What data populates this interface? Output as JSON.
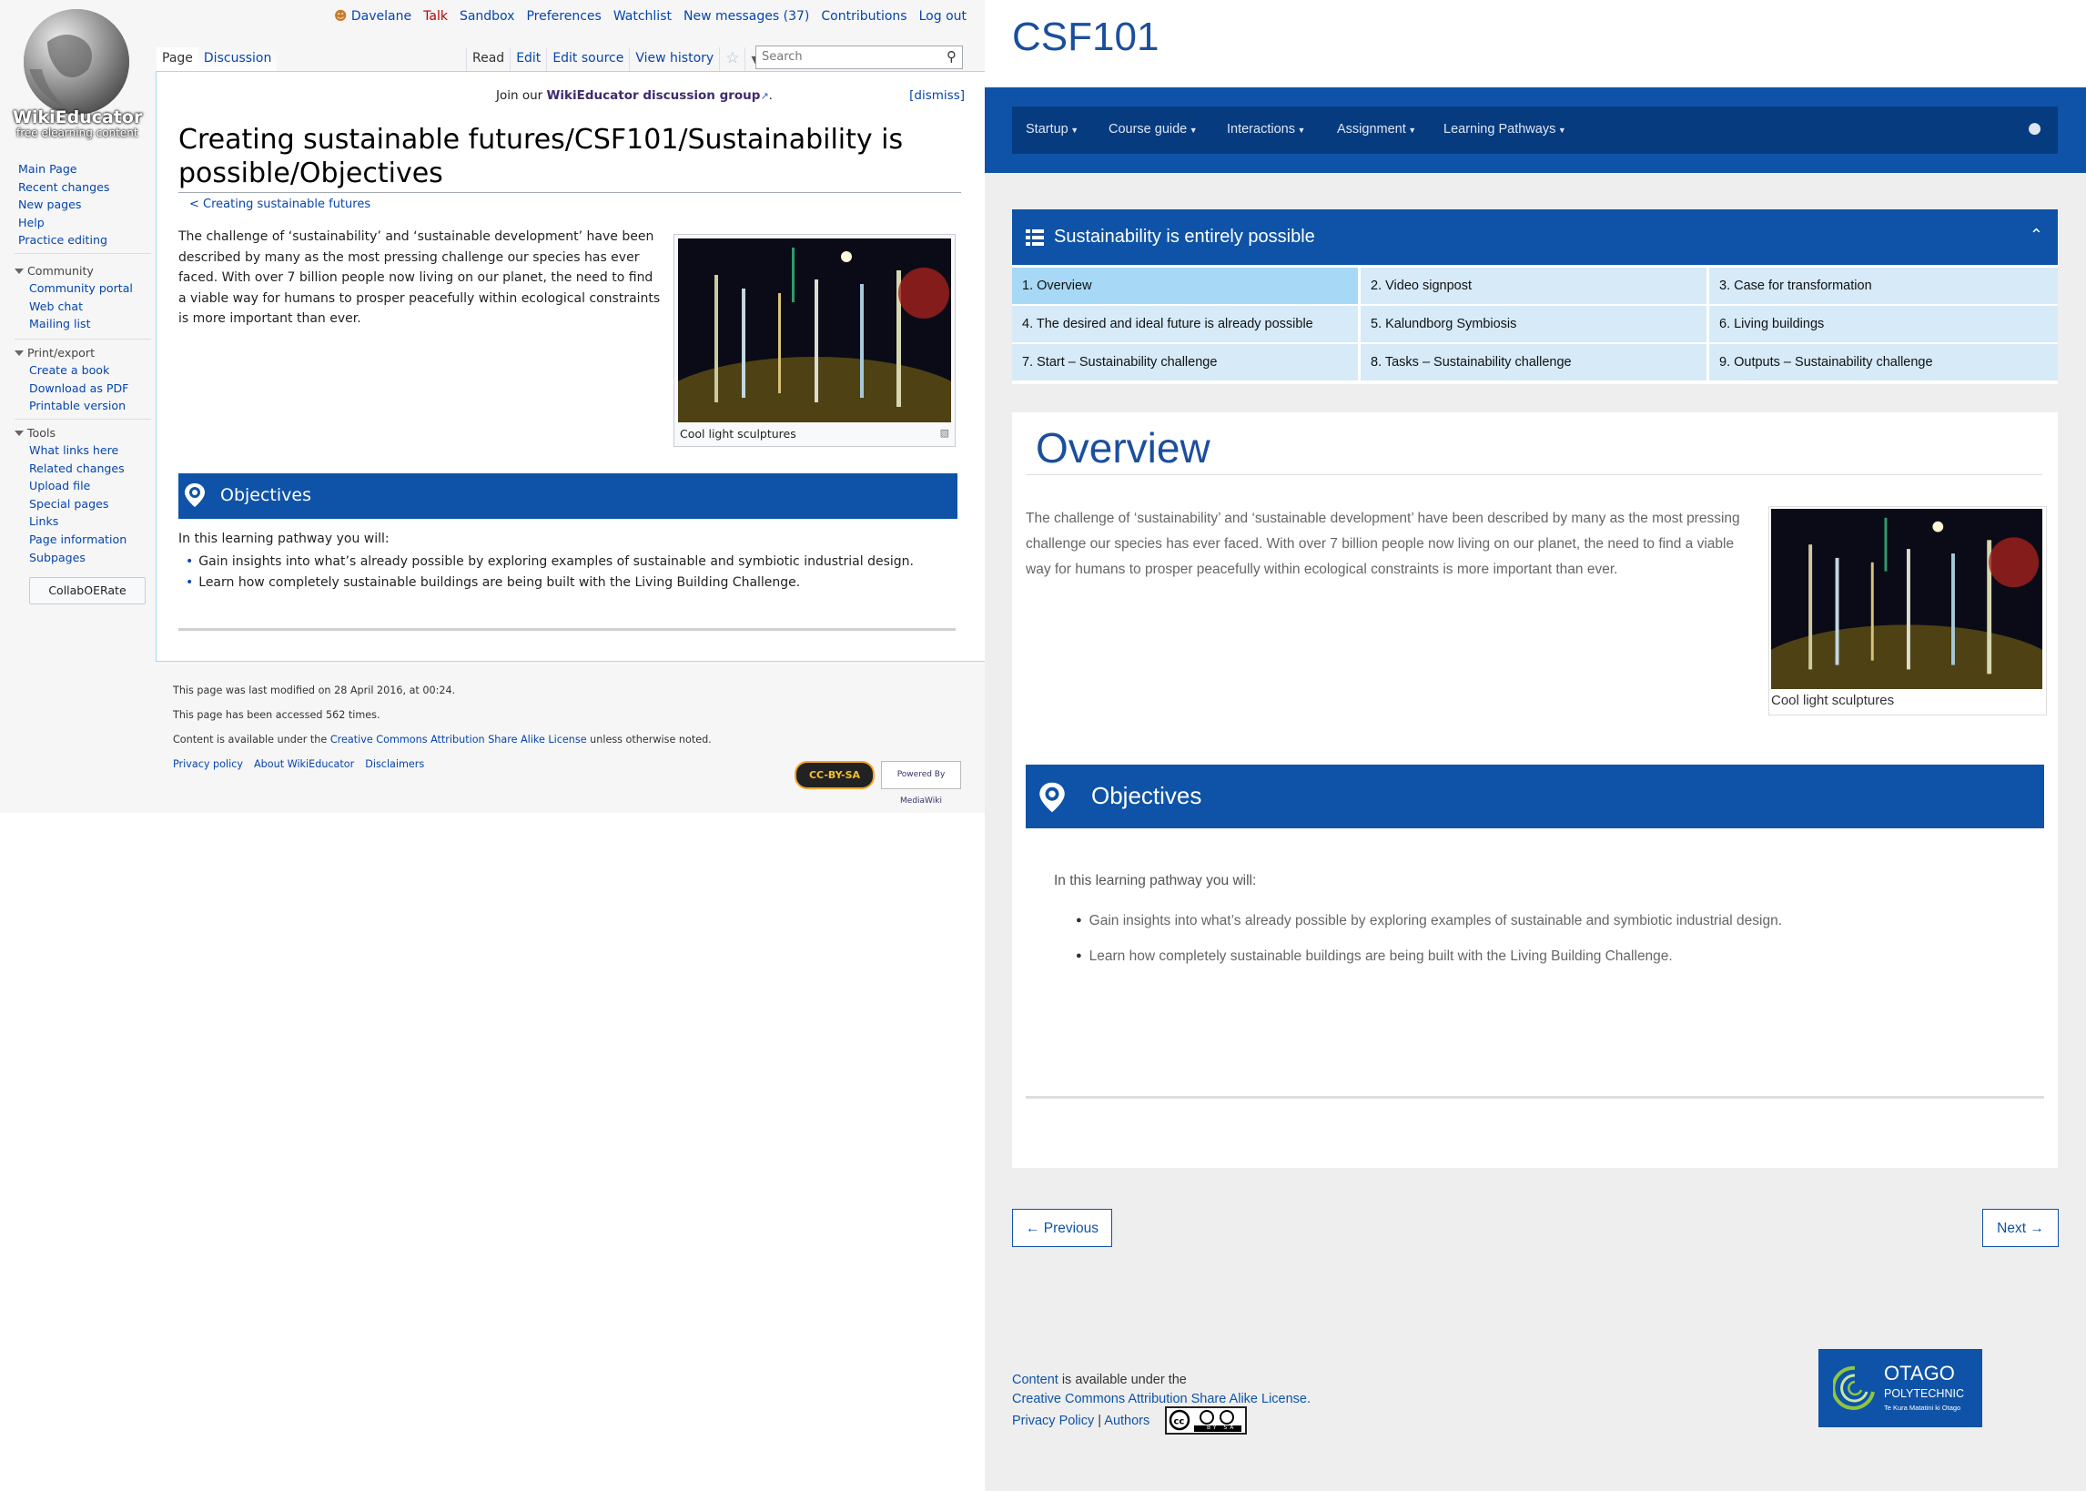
{
  "wiki": {
    "logo": {
      "title": "WikiEducator",
      "tagline": "free elearning content"
    },
    "personal": {
      "user": "Davelane",
      "talk": "Talk",
      "sandbox": "Sandbox",
      "preferences": "Preferences",
      "watchlist": "Watchlist",
      "messages": "New messages (37)",
      "contributions": "Contributions",
      "logout": "Log out"
    },
    "tabs": {
      "page": "Page",
      "discussion": "Discussion",
      "read": "Read",
      "edit": "Edit",
      "edit_source": "Edit source",
      "view_history": "View history"
    },
    "search": {
      "placeholder": "Search"
    },
    "sitenotice": {
      "prefix": "Join our ",
      "link": "WikiEducator discussion group",
      "suffix": ".",
      "dismiss": "[dismiss]"
    },
    "title": "Creating sustainable futures/CSF101/Sustainability is possible/Objectives",
    "breadcrumb": "< Creating sustainable futures",
    "paragraph": "The challenge of ‘sustainability’ and ‘sustainable development’ have been described by many as the most pressing challenge our species has ever faced. With over 7 billion people now living on our planet, the need to find a viable way for humans to prosper peacefully within ecological constraints is more important than ever.",
    "thumb_caption": "Cool light sculptures",
    "objectives_title": "Objectives",
    "objectives_intro": "In this learning pathway you will:",
    "objectives_items": [
      "Gain insights into what’s already possible by exploring examples of sustainable and symbiotic industrial design.",
      "Learn how completely sustainable buildings are being built with the Living Building Challenge."
    ],
    "sidebar": {
      "nav": [
        "Main Page",
        "Recent changes",
        "New pages",
        "Help",
        "Practice editing"
      ],
      "community_label": "Community",
      "community": [
        "Community portal",
        "Web chat",
        "Mailing list"
      ],
      "print_label": "Print/export",
      "print": [
        "Create a book",
        "Download as PDF",
        "Printable version"
      ],
      "tools_label": "Tools",
      "tools": [
        "What links here",
        "Related changes",
        "Upload file",
        "Special pages",
        "Links",
        "Page information",
        "Subpages"
      ],
      "collab": "CollabOERate"
    },
    "footer": {
      "modified": "This page was last modified on 28 April 2016, at 00:24.",
      "accessed": "This page has been accessed 562 times.",
      "license_prefix": "Content is available under the ",
      "license_link": "Creative Commons Attribution Share Alike License",
      "license_suffix": " unless otherwise noted.",
      "links": [
        "Privacy policy",
        "About WikiEducator",
        "Disclaimers"
      ],
      "cc_badge": "CC-BY-SA",
      "mw_badge": "Powered By MediaWiki"
    }
  },
  "course": {
    "site_title": "CSF101",
    "nav": [
      "Startup",
      "Course guide",
      "Interactions",
      "Assignment",
      "Learning Pathways"
    ],
    "panel_title": "Sustainability is entirely possible",
    "pages": [
      "1. Overview",
      "2. Video signpost",
      "3. Case for transformation",
      "4. The desired and ideal future is already possible",
      "5. Kalundborg Symbiosis",
      "6. Living buildings",
      "7. Start – Sustainability challenge",
      "8. Tasks – Sustainability challenge",
      "9. Outputs – Sustainability challenge"
    ],
    "selected_page": "1. Overview",
    "heading": "Overview",
    "paragraph": "The challenge of ‘sustainability’ and ‘sustainable development’ have been described by many as the most pressing challenge our species has ever faced. With over 7 billion people now living on our planet, the need to find a viable way for humans to prosper peacefully within ecological constraints is more important than ever.",
    "thumb_caption": "Cool light sculptures",
    "objectives_title": "Objectives",
    "objectives_intro": "In this learning pathway you will:",
    "objectives_items": [
      "Gain insights into what’s already possible by exploring examples of sustainable and symbiotic industrial design.",
      "Learn how completely sustainable buildings are being built with the Living Building Challenge."
    ],
    "prev": "← Previous",
    "next": "Next →",
    "footer": {
      "content_link": "Content",
      "content_suffix": " is available under the",
      "license_link": "Creative Commons Attribution Share Alike License.",
      "privacy": "Privacy Policy",
      "sep": " | ",
      "authors": "Authors",
      "cc_logo_text": "BY SA"
    },
    "otago": {
      "name": "OTAGO",
      "sub": "POLYTECHNIC",
      "maori": "Te Kura Matatini ki Otago"
    }
  },
  "colors": {
    "brand_blue": "#0e53a7",
    "nav_dark": "#063b80",
    "cell_light": "#d6eaf8",
    "cell_selected": "#a7d8f5",
    "wiki_link": "#0645ad"
  }
}
